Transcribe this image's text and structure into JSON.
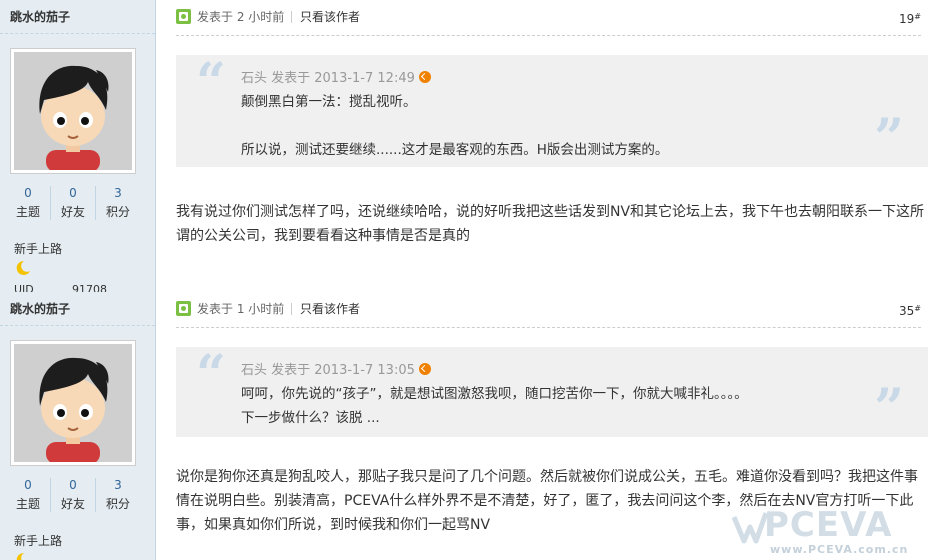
{
  "posts": [
    {
      "author": {
        "name": "跳水的茄子",
        "stats": [
          {
            "value": "0",
            "label": "主题"
          },
          {
            "value": "0",
            "label": "好友"
          },
          {
            "value": "3",
            "label": "积分"
          }
        ],
        "rank": "新手上路",
        "rank_icon": "moon-icon",
        "uid_label": "UID",
        "uid_value": "91708"
      },
      "meta": {
        "posted": "发表于 2 小时前",
        "only_author": "只看该作者",
        "floor": "19",
        "floor_mark": "#"
      },
      "quote": {
        "header": "石头 发表于 2013-1-7 12:49",
        "lines": [
          "颠倒黑白第一法：搅乱视听。",
          "",
          "所以说，测试还要继续......这才是最客观的东西。H版会出测试方案的。"
        ]
      },
      "body": "我有说过你们测试怎样了吗，还说继续哈哈，说的好听我把这些话发到NV和其它论坛上去，我下午也去朝阳联系一下这所谓的公关公司，我到要看看这种事情是否是真的"
    },
    {
      "author": {
        "name": "跳水的茄子",
        "stats": [
          {
            "value": "0",
            "label": "主题"
          },
          {
            "value": "0",
            "label": "好友"
          },
          {
            "value": "3",
            "label": "积分"
          }
        ],
        "rank": "新手上路",
        "rank_icon": "moon-icon"
      },
      "meta": {
        "posted": "发表于 1 小时前",
        "only_author": "只看该作者",
        "floor": "35",
        "floor_mark": "#"
      },
      "quote": {
        "header": "石头 发表于 2013-1-7 13:05",
        "lines": [
          "呵呵，你先说的“孩子”，就是想试图激怒我呗，随口挖苦你一下，你就大喊非礼。。。。",
          "下一步做什么？该脱 ..."
        ]
      },
      "body": "说你是狗你还真是狗乱咬人，那贴子我只是问了几个问题。然后就被你们说成公关，五毛。难道你没看到吗？我把这件事情在说明白些。别装清高，PCEVA什么样外界不是不清楚，好了，匿了，我去问问这个李，然后在去NV官方打听一下此事，如果真如你们所说，到时候我和你们一起骂NV"
    }
  ],
  "watermark": {
    "logo": "PCEVA",
    "url": "www.PCEVA.com.cn"
  },
  "colors": {
    "sidebar_bg": "#e5edf2",
    "quote_bg": "#f0f0f0",
    "link": "#336699",
    "quote_mark": "#c9d9e8"
  }
}
